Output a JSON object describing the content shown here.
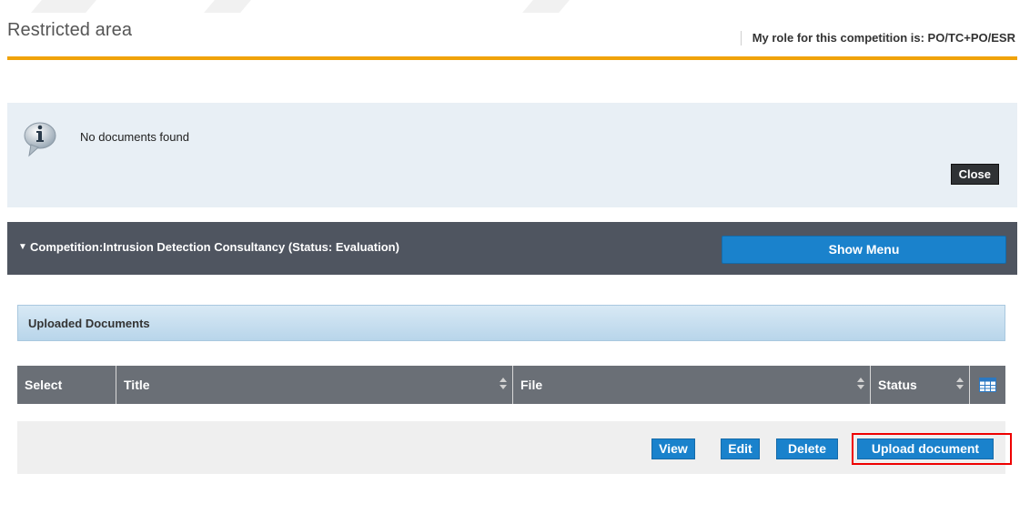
{
  "header": {
    "title": "Restricted area",
    "role_text": "My role for this competition is: PO/TC+PO/ESR"
  },
  "info": {
    "icon": "info-icon",
    "message": "No documents found",
    "close_label": "Close"
  },
  "competition": {
    "caret_icon": "caret-down-icon",
    "label": "Competition:Intrusion Detection Consultancy (Status: Evaluation)",
    "show_menu_label": "Show Menu"
  },
  "panel": {
    "title": "Uploaded Documents"
  },
  "table": {
    "columns": [
      "Select",
      "Title",
      "File",
      "Status"
    ],
    "column_chooser_icon": "table-columns-icon"
  },
  "actions": {
    "view_label": "View",
    "edit_label": "Edit",
    "delete_label": "Delete",
    "upload_label": "Upload document"
  },
  "colors": {
    "accent_orange": "#f0a30a",
    "button_blue": "#1a82cc",
    "dark_bar": "#4f5560",
    "table_header": "#6a6f76",
    "highlight_red": "#e00000"
  }
}
